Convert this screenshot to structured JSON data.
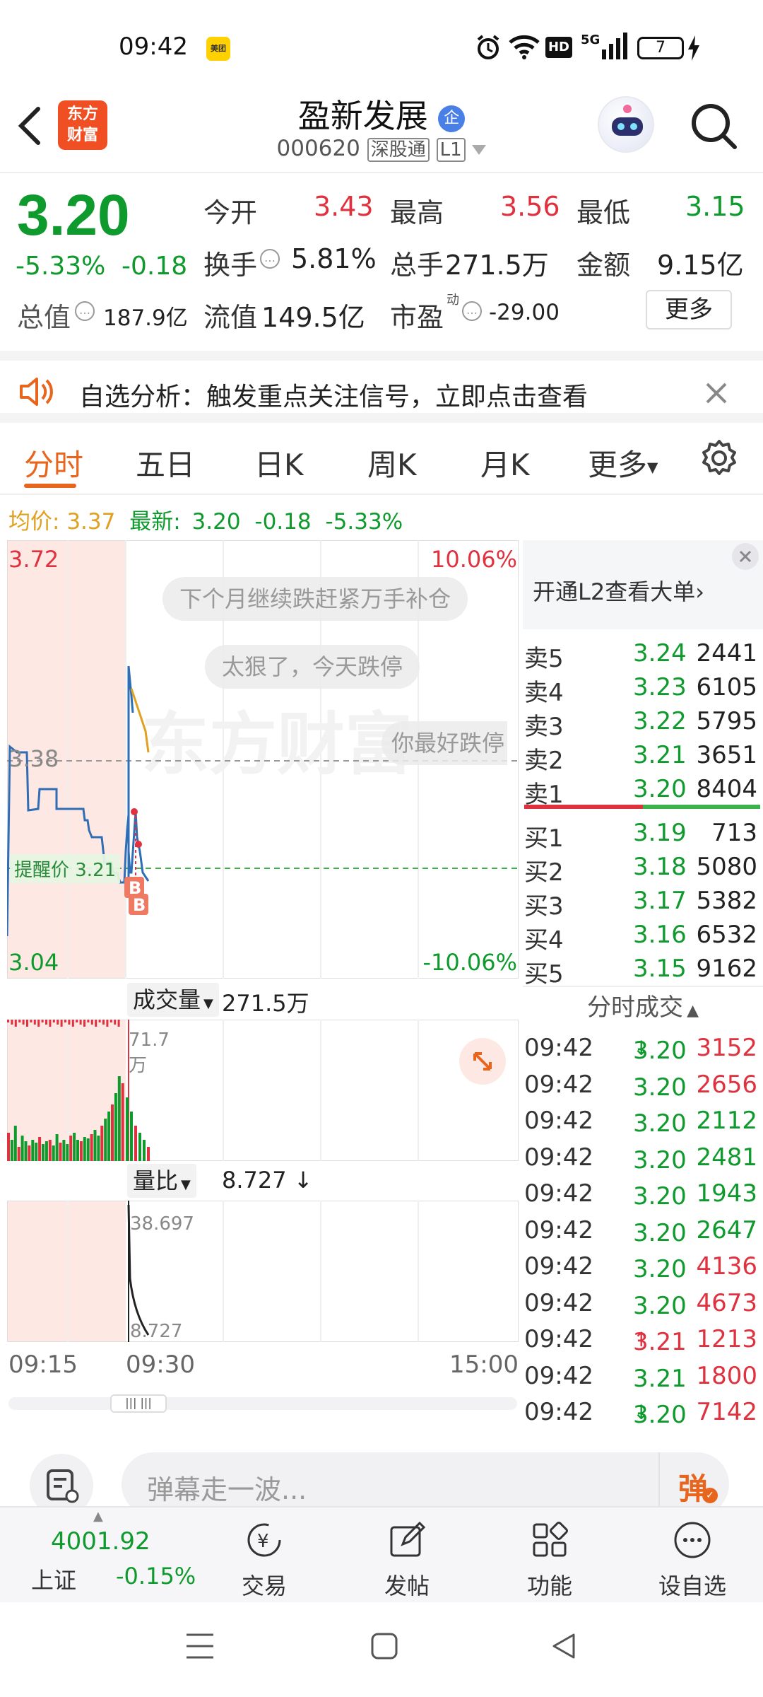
{
  "status_bar": {
    "time": "09:42",
    "meituan": "美团",
    "network": "5G",
    "battery": "7"
  },
  "header": {
    "logo_line1": "东方",
    "logo_line2": "财富",
    "stock_name": "盈新发展",
    "code": "000620",
    "tag1": "深股通",
    "tag2": "L1"
  },
  "quote": {
    "price": "3.20",
    "change_pct": "-5.33%",
    "change": "-0.18",
    "open_label": "今开",
    "open": "3.43",
    "high_label": "最高",
    "high": "3.56",
    "low_label": "最低",
    "low": "3.15",
    "turnover_label": "换手",
    "turnover": "5.81%",
    "volume_label": "总手",
    "volume": "271.5万",
    "amount_label": "金额",
    "amount": "9.15亿",
    "mktcap_label": "总值",
    "mktcap": "187.9亿",
    "float_label": "流值",
    "float": "149.5亿",
    "pe_label": "市盈",
    "pe_sup": "动",
    "pe": "-29.00",
    "more_label": "更多"
  },
  "notice": {
    "text": "自选分析：触发重点关注信号，立即点击查看"
  },
  "tabs": [
    "分时",
    "五日",
    "日K",
    "周K",
    "月K",
    "更多"
  ],
  "info_line": {
    "avg_label": "均价:",
    "avg": "3.37",
    "latest_label": "最新:",
    "latest": "3.20",
    "change": "-0.18",
    "change_pct": "-5.33%"
  },
  "chart": {
    "y_top": "3.72",
    "y_bottom": "3.04",
    "pct_top": "10.06%",
    "pct_bottom": "-10.06%",
    "mid_label": "3.38",
    "alert_label": "提醒价 3.21",
    "danmu1": "下个月继续跌赶紧万手补仓",
    "danmu2": "太狠了，今天跌停",
    "danmu3": "你最好跌停",
    "watermark": "东方财富",
    "vol_label": "成交量",
    "vol_value": "271.5万",
    "vol_max": "71.7万",
    "ratio_label": "量比",
    "ratio_value": "8.727",
    "ratio_max": "38.697",
    "ratio_min": "8.727",
    "time_start": "09:15",
    "time_open": "09:30",
    "time_end": "15:00"
  },
  "chart_data": {
    "type": "line",
    "x": [
      "09:15",
      "09:30",
      "15:00"
    ],
    "ylim": [
      3.04,
      3.72
    ],
    "series": [
      {
        "values": [
          3.38,
          3.55,
          3.3,
          3.26,
          3.21,
          3.2
        ]
      }
    ],
    "volume_max": "71.7万",
    "volume_ratio": {
      "max": 38.697,
      "current": 8.727
    }
  },
  "side_panel": {
    "l2_text": "开通L2查看大单",
    "asks": [
      {
        "label": "卖5",
        "price": "3.24",
        "vol": "2441"
      },
      {
        "label": "卖4",
        "price": "3.23",
        "vol": "6105"
      },
      {
        "label": "卖3",
        "price": "3.22",
        "vol": "5795"
      },
      {
        "label": "卖2",
        "price": "3.21",
        "vol": "3651"
      },
      {
        "label": "卖1",
        "price": "3.20",
        "vol": "8404"
      }
    ],
    "bids": [
      {
        "label": "买1",
        "price": "3.19",
        "vol": "713"
      },
      {
        "label": "买2",
        "price": "3.18",
        "vol": "5080"
      },
      {
        "label": "买3",
        "price": "3.17",
        "vol": "5382"
      },
      {
        "label": "买4",
        "price": "3.16",
        "vol": "6532"
      },
      {
        "label": "买5",
        "price": "3.15",
        "vol": "9162"
      }
    ],
    "trades_header": "分时成交",
    "trades": [
      {
        "time": "09:42",
        "price": "3.20",
        "dir": "↓",
        "vol": "3152",
        "c": "red"
      },
      {
        "time": "09:42",
        "price": "3.20",
        "dir": "",
        "vol": "2656",
        "c": "red"
      },
      {
        "time": "09:42",
        "price": "3.20",
        "dir": "",
        "vol": "2112",
        "c": "green"
      },
      {
        "time": "09:42",
        "price": "3.20",
        "dir": "",
        "vol": "2481",
        "c": "green"
      },
      {
        "time": "09:42",
        "price": "3.20",
        "dir": "",
        "vol": "1943",
        "c": "green"
      },
      {
        "time": "09:42",
        "price": "3.20",
        "dir": "",
        "vol": "2647",
        "c": "green"
      },
      {
        "time": "09:42",
        "price": "3.20",
        "dir": "",
        "vol": "4136",
        "c": "red"
      },
      {
        "time": "09:42",
        "price": "3.20",
        "dir": "",
        "vol": "4673",
        "c": "red"
      },
      {
        "time": "09:42",
        "price": "3.21",
        "dir": "↑",
        "vol": "1213",
        "c": "red"
      },
      {
        "time": "09:42",
        "price": "3.21",
        "dir": "",
        "vol": "1800",
        "c": "red"
      },
      {
        "time": "09:42",
        "price": "3.20",
        "dir": "↓",
        "vol": "7142",
        "c": "red"
      }
    ]
  },
  "comment": {
    "placeholder": "弹幕走一波...",
    "danmu_toggle": "弹"
  },
  "bottom_bar": {
    "index_value": "4001.92",
    "index_name": "上证",
    "index_change": "-0.15%",
    "trade": "交易",
    "post": "发帖",
    "features": "功能",
    "set_watch": "设自选"
  },
  "colors": {
    "up": "#e0313f",
    "down": "#0e9a2c",
    "accent": "#e8651e",
    "avg_line": "#e0a020",
    "price_line": "#2f6db5"
  }
}
